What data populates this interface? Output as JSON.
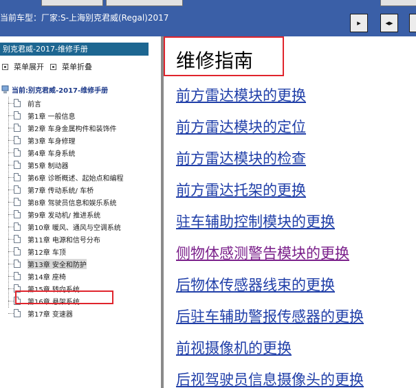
{
  "header": {
    "car_model": "当前车型：厂家:S-上海别克君威(Regal)2017"
  },
  "toolbar": {
    "buttons": [
      {
        "icon": "panel-left-icon",
        "glyph": "▸"
      },
      {
        "icon": "expand-both-icon",
        "glyph": "◂▸"
      },
      {
        "icon": "panel-right-icon",
        "glyph": "◂"
      }
    ]
  },
  "sidebar": {
    "manual_title": "别克君威-2017-维修手册",
    "expand_label": "菜单展开",
    "collapse_label": "菜单折叠",
    "root_label": "当前:别克君威-2017-维修手册",
    "selected_index": 14,
    "items": [
      {
        "label": "前言"
      },
      {
        "label": "第1章 一般信息"
      },
      {
        "label": "第2章 车身金属构件和装饰件"
      },
      {
        "label": "第3章 车身修理"
      },
      {
        "label": "第4章 车身系统"
      },
      {
        "label": "第5章 制动器"
      },
      {
        "label": "第6章 诊断概述、起始点和编程"
      },
      {
        "label": "第7章 传动系统/ 车桥"
      },
      {
        "label": "第8章 驾驶员信息和娱乐系统"
      },
      {
        "label": "第9章 发动机/ 推进系统"
      },
      {
        "label": "第10章 暖风、通风与空调系统"
      },
      {
        "label": "第11章 电源和信号分布"
      },
      {
        "label": "第12章 车顶"
      },
      {
        "label": "第13章 安全和防护"
      },
      {
        "label": "第14章 座椅"
      },
      {
        "label": "第15章 转向系统"
      },
      {
        "label": "第16章 悬架系统"
      },
      {
        "label": "第17章 变速器"
      }
    ]
  },
  "main": {
    "title": "维修指南",
    "links": [
      {
        "label": "前方雷达模块的更换",
        "visited": false
      },
      {
        "label": "前方雷达模块的定位",
        "visited": false
      },
      {
        "label": "前方雷达模块的检查",
        "visited": false
      },
      {
        "label": "前方雷达托架的更换",
        "visited": false
      },
      {
        "label": "驻车辅助控制模块的更换",
        "visited": false
      },
      {
        "label": "侧物体感测警告模块的更换",
        "visited": true
      },
      {
        "label": "后物体传感器线束的更换",
        "visited": false
      },
      {
        "label": "后驻车辅助警报传感器的更换",
        "visited": false
      },
      {
        "label": "前视摄像机的更换",
        "visited": false
      },
      {
        "label": "后视驾驶员信息摄像头的更换",
        "visited": false
      }
    ]
  },
  "colors": {
    "header_bg": "#3a5fa7",
    "title_bar_bg": "#1d6691",
    "link": "#1f3ea8",
    "link_visited": "#7a1f8a",
    "annotation_red": "#e0242c"
  }
}
